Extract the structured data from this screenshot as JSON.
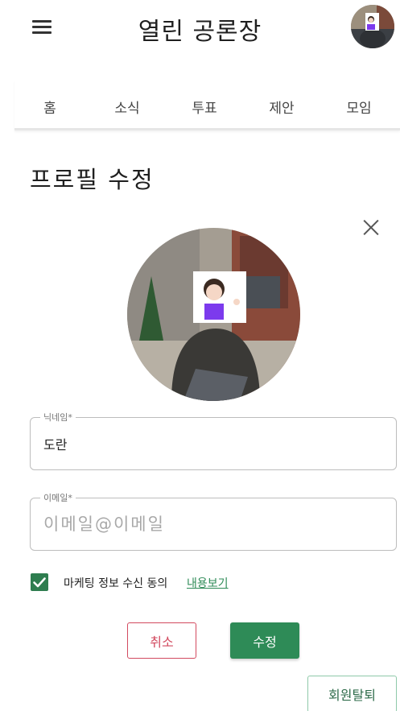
{
  "app": {
    "title": "열린 공론장"
  },
  "icons": {
    "menu": "hamburger-menu-icon",
    "close": "close-icon",
    "check": "check-icon"
  },
  "nav": {
    "tabs": [
      {
        "label": "홈"
      },
      {
        "label": "소식"
      },
      {
        "label": "투표"
      },
      {
        "label": "제안"
      },
      {
        "label": "모임"
      }
    ]
  },
  "page": {
    "title": "프로필 수정"
  },
  "form": {
    "nickname": {
      "label": "닉네임*",
      "value": "도란"
    },
    "email": {
      "label": "이메일*",
      "value": "",
      "placeholder": "이메일@이메일"
    },
    "marketing": {
      "checked": true,
      "label": "마케팅 정보 수신 동의",
      "link": "내용보기"
    }
  },
  "buttons": {
    "cancel": "취소",
    "save": "수정",
    "withdraw": "회원탈퇴"
  },
  "colors": {
    "accent": "#2e8b57",
    "danger": "#d24a5f",
    "checkbox": "#2e7d4f"
  }
}
